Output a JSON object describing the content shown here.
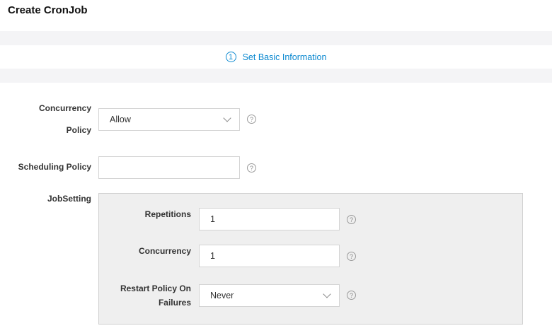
{
  "page": {
    "title": "Create CronJob"
  },
  "steps": [
    {
      "number": "1",
      "label": "Set Basic Information"
    }
  ],
  "form": {
    "concurrency_policy": {
      "label_line1": "Concurrency",
      "label_line2": "Policy",
      "value": "Allow",
      "help": "?"
    },
    "scheduling_policy": {
      "label": "Scheduling Policy",
      "value": "",
      "help": "?"
    },
    "job_setting": {
      "label": "JobSetting",
      "repetitions": {
        "label": "Repetitions",
        "value": "1",
        "help": "?"
      },
      "concurrency": {
        "label": "Concurrency",
        "value": "1",
        "help": "?"
      },
      "restart_policy": {
        "label_line1": "Restart Policy On",
        "label_line2": "Failures",
        "value": "Never",
        "help": "?"
      }
    }
  },
  "colors": {
    "accent": "#0a88d0",
    "band": "#f4f4f6",
    "panel": "#efefef",
    "border": "#d4d4d4"
  }
}
